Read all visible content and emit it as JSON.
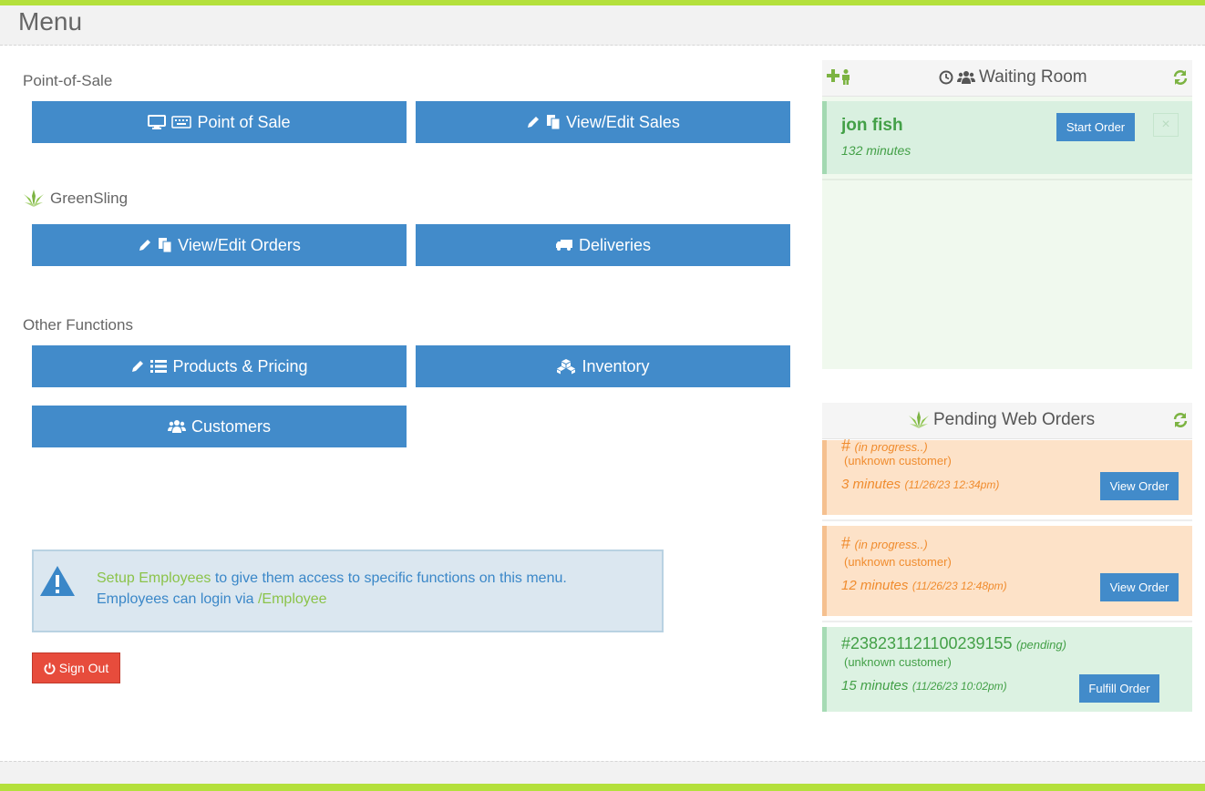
{
  "header": {
    "title": "Menu"
  },
  "sections": {
    "pos_label": "Point-of-Sale",
    "greensling_label": "GreenSling",
    "other_label": "Other Functions"
  },
  "buttons": {
    "point_of_sale": "Point of Sale",
    "view_edit_sales": "View/Edit Sales",
    "view_edit_orders": "View/Edit Orders",
    "deliveries": "Deliveries",
    "products_pricing": "Products & Pricing",
    "inventory": "Inventory",
    "customers": "Customers"
  },
  "info": {
    "link_setup": "Setup Employees",
    "text1": " to give them access to specific functions on this menu.",
    "text2": "Employees can login via ",
    "link_employee": "/Employee"
  },
  "signout": {
    "label": "Sign Out"
  },
  "waiting_room": {
    "title": "Waiting Room",
    "customer": {
      "name": "jon fish",
      "wait": "132 minutes",
      "start_label": "Start Order",
      "dismiss_symbol": "×"
    }
  },
  "pending_orders": {
    "title": "Pending Web Orders",
    "orders": [
      {
        "number": "#",
        "status": "(in progress..)",
        "customer": "(unknown customer)",
        "age": "3 minutes",
        "time": "(11/26/23 12:34pm)",
        "action": "View Order"
      },
      {
        "number": "#",
        "status": "(in progress..)",
        "customer": "(unknown customer)",
        "age": "12 minutes",
        "time": "(11/26/23 12:48pm)",
        "action": "View Order"
      },
      {
        "number": "#238231121100239155",
        "status": "(pending)",
        "customer": "(unknown customer)",
        "age": "15 minutes",
        "time": "(11/26/23 10:02pm)",
        "action": "Fulfill Order"
      }
    ]
  },
  "colors": {
    "accent_green": "#b4e03c",
    "button_blue": "#428bca",
    "danger_red": "#e74c3c",
    "waiting_green": "#4caf50",
    "order_orange": "#f08c2e"
  }
}
